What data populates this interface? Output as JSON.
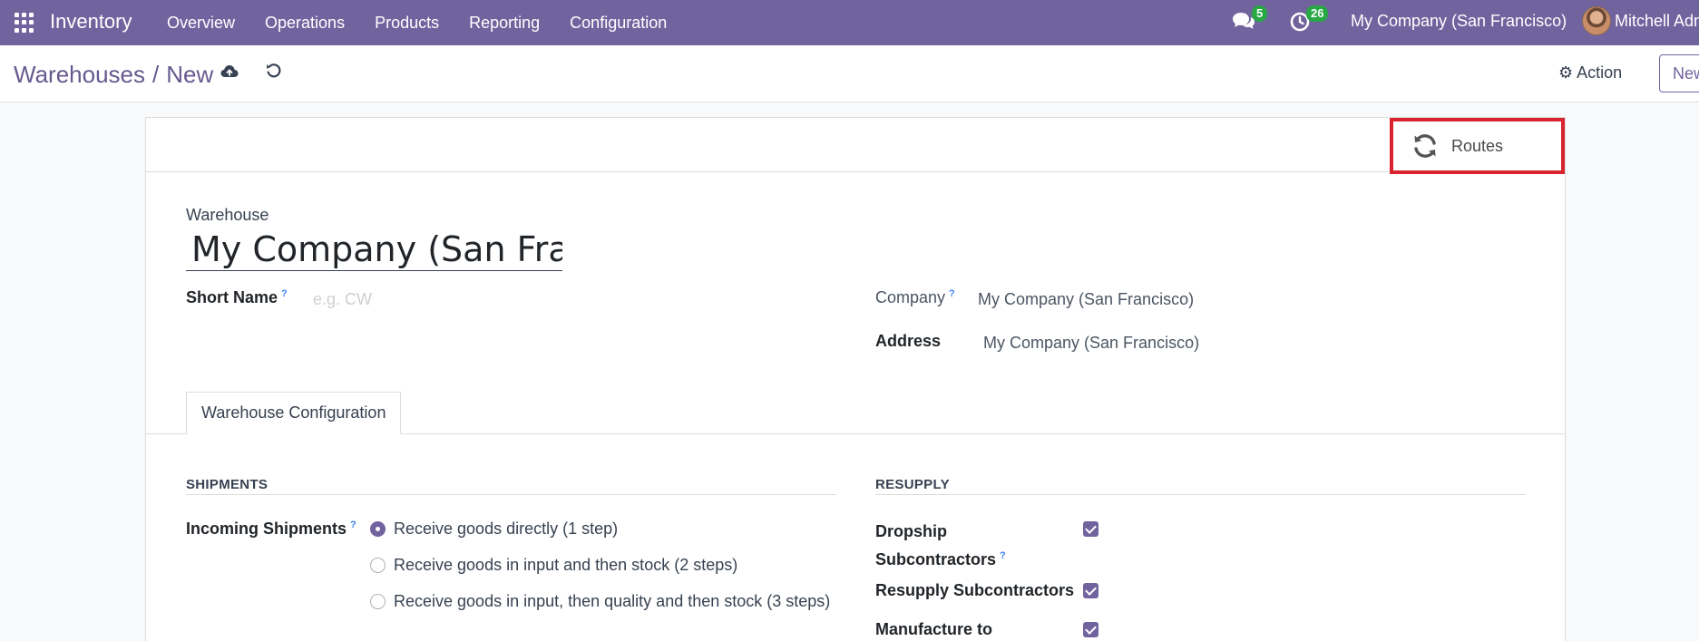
{
  "navbar": {
    "brand": "Inventory",
    "menu": [
      "Overview",
      "Operations",
      "Products",
      "Reporting",
      "Configuration"
    ],
    "messages_count": "5",
    "activities_count": "26",
    "company": "My Company (San Francisco)",
    "user": "Mitchell Admin",
    "accent_color": "#71639e"
  },
  "control_panel": {
    "breadcrumb_parent": "Warehouses",
    "breadcrumb_separator": "/",
    "breadcrumb_current": "New",
    "action_label": "Action",
    "new_label": "New"
  },
  "button_box": {
    "routes_label": "Routes",
    "highlight_color": "#d9232e"
  },
  "form": {
    "warehouse_label": "Warehouse",
    "warehouse_name": "My Company (San Francis",
    "short_name_label": "Short Name",
    "short_name_placeholder": "e.g. CW",
    "help_mark": "?",
    "company_label": "Company",
    "company_value": "My Company (San Francisco)",
    "address_label": "Address",
    "address_value": "My Company (San Francisco)"
  },
  "tabs": {
    "active": "Warehouse Configuration"
  },
  "shipments": {
    "title": "SHIPMENTS",
    "incoming_label": "Incoming Shipments",
    "options": [
      {
        "label": "Receive goods directly (1 step)",
        "checked": true
      },
      {
        "label": "Receive goods in input and then stock (2 steps)",
        "checked": false
      },
      {
        "label": "Receive goods in input, then quality and then stock (3 steps)",
        "checked": false
      }
    ]
  },
  "resupply": {
    "title": "RESUPPLY",
    "dropship_label": "Dropship Subcontractors",
    "resupply_label": "Resupply Subcontractors",
    "manufacture_label": "Manufacture to"
  }
}
